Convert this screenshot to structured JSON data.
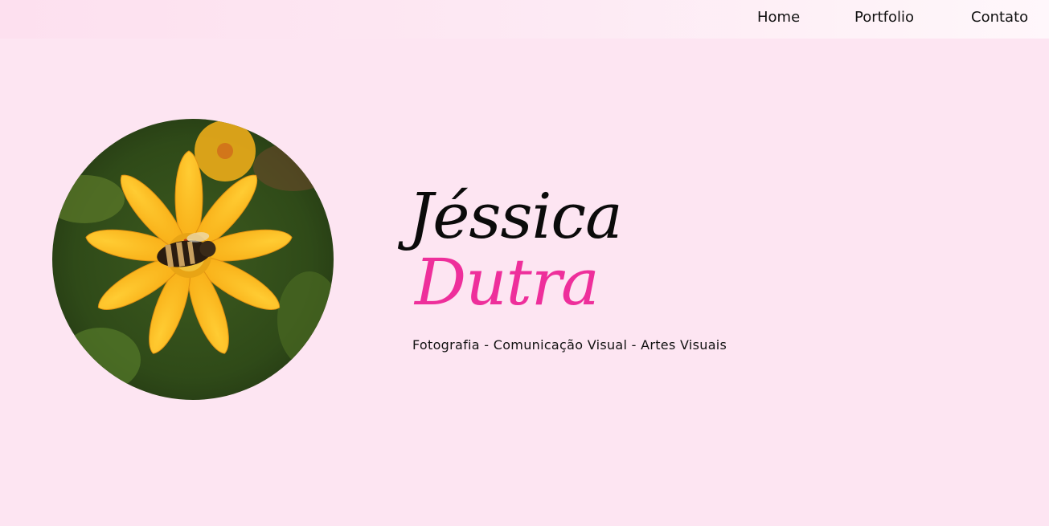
{
  "nav": {
    "items": [
      {
        "label": "Home"
      },
      {
        "label": "Portfolio"
      },
      {
        "label": "Contato"
      }
    ]
  },
  "hero": {
    "first_name": "Jéssica",
    "last_name": "Dutra",
    "tagline": "Fotografia - Comunicação Visual - Artes Visuais",
    "avatar_icon": "flower-bee-photo"
  },
  "colors": {
    "background": "#fde5f2",
    "accent": "#ee2f9b",
    "text": "#111111"
  }
}
